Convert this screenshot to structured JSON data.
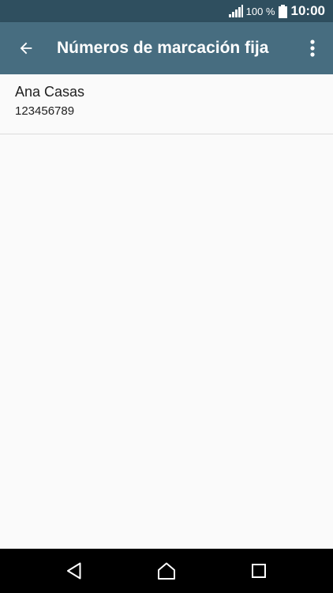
{
  "status_bar": {
    "battery_percent": "100 %",
    "time": "10:00",
    "signal_icon": "signal-bars-icon",
    "battery_icon": "battery-full-icon"
  },
  "app_bar": {
    "title": "Números de marcación fija",
    "back_icon": "arrow-left-icon",
    "menu_icon": "more-vertical-icon"
  },
  "list": {
    "items": [
      {
        "name": "Ana Casas",
        "number": "123456789"
      }
    ]
  },
  "nav_bar": {
    "back_icon": "triangle-back-icon",
    "home_icon": "home-icon",
    "recents_icon": "square-recents-icon"
  },
  "colors": {
    "status_bar": "#2f4f5f",
    "app_bar": "#476d80",
    "background": "#fafafa",
    "nav_bar": "#000000"
  }
}
